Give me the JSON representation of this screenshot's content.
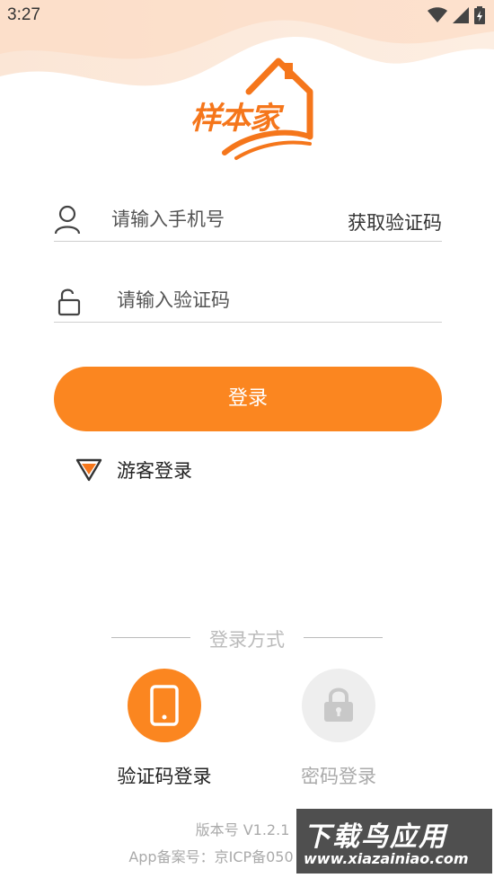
{
  "status_bar": {
    "time": "3:27"
  },
  "brand": {
    "logo_text": "样本家",
    "accent_color": "#fb8620"
  },
  "form": {
    "phone_placeholder": "请输入手机号",
    "get_code_label": "获取验证码",
    "code_placeholder": "请输入验证码",
    "login_label": "登录"
  },
  "guest": {
    "label": "游客登录"
  },
  "login_methods": {
    "title": "登录方式",
    "items": [
      {
        "label": "验证码登录",
        "icon": "phone-icon",
        "active": true
      },
      {
        "label": "密码登录",
        "icon": "lock-icon",
        "active": false
      }
    ]
  },
  "footer": {
    "version": "版本号 V1.2.1",
    "icp": "App备案号：京ICP备050"
  },
  "watermark": {
    "main": "下载鸟应用",
    "sub": "www.xiazainiao.com"
  }
}
